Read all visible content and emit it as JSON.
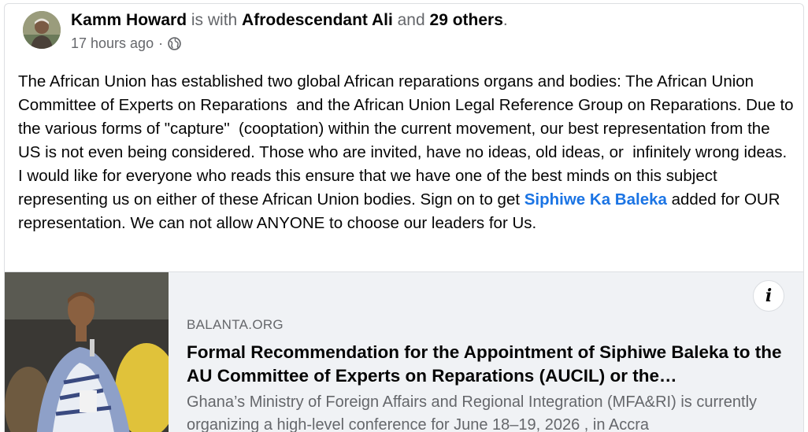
{
  "post": {
    "author": "Kamm Howard",
    "with_text": " is with ",
    "tagged": "Afrodescendant Ali",
    "and_text": " and ",
    "others": "29 others",
    "period": ".",
    "timestamp": "17 hours ago",
    "separator": " · ",
    "audience_icon": "globe-icon",
    "text_before_mention": "The African Union has established two global African reparations organs and bodies: The African Union Committee of Experts on Reparations  and the African Union Legal Reference Group on Reparations. Due to the various forms of \"capture\"  (cooptation) within the current movement, our best representation from the US is not even being considered. Those who are invited, have no ideas, old ideas, or  infinitely wrong ideas. I would like for everyone who reads this ensure that we have one of the best minds on this subject representing us on either of these African Union bodies. Sign on to get ",
    "mention": "Siphiwe Ka Baleka",
    "text_after_mention": " added for OUR representation. We can not allow ANYONE to choose our leaders for Us."
  },
  "link_card": {
    "domain": "BALANTA.ORG",
    "headline": "Formal Recommendation for the Appointment of Siphiwe Baleka to the AU Committee of Experts on Reparations (AUCIL) or the…",
    "description": "Ghana’s Ministry of Foreign Affairs and Regional Integration (MFA&RI) is currently organizing a high-level conference for June 18–19, 2026 , in Accra",
    "info_icon": "i"
  },
  "colors": {
    "mention": "#1b74e4",
    "muted": "#65676b",
    "card_bg": "#f0f2f5"
  }
}
